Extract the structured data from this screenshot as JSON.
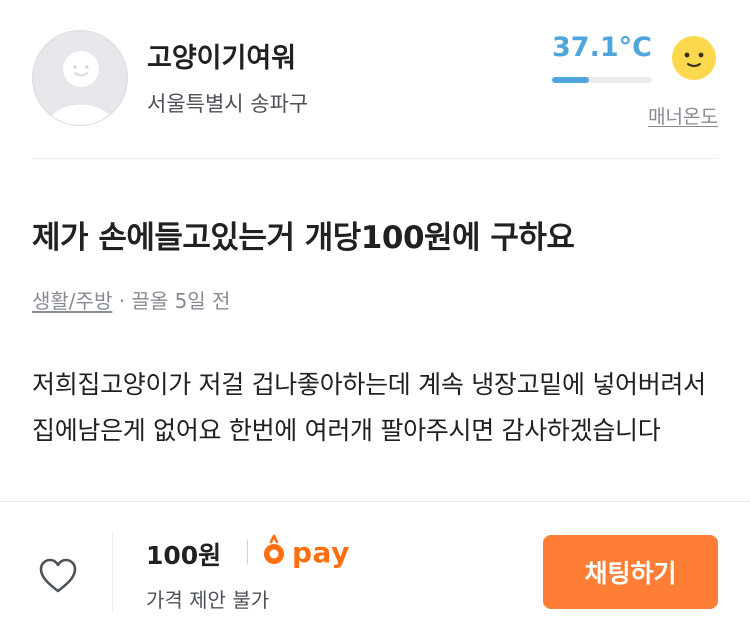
{
  "seller": {
    "nickname": "고양이기여워",
    "region": "서울특별시 송파구",
    "avatar_icon": "default-profile-icon",
    "manner": {
      "temperature_text": "37.1°C",
      "temperature_fraction": 0.371,
      "label": "매너온도",
      "face_icon": "smiley-face-icon",
      "color": "#4ea6dc"
    }
  },
  "post": {
    "title": "제가 손에들고있는거 개당100원에 구하요",
    "category": "생활/주방",
    "meta_sep": " · ",
    "bump_time": "끌올 5일 전",
    "body": "저희집고양이가 저걸 겁나좋아하는데 계속 냉장고밑에 넣어버려서 집에남은게 없어요 한번에 여러개 팔아주시면 감사하겠습니다"
  },
  "bottom_bar": {
    "like_icon": "heart-outline-icon",
    "price": "100원",
    "pay_label": "pay",
    "pay_icon": "carrot-pay-icon",
    "negotiation": "가격 제안 불가",
    "chat_button": "채팅하기",
    "accent_color": "#ff7e36"
  }
}
